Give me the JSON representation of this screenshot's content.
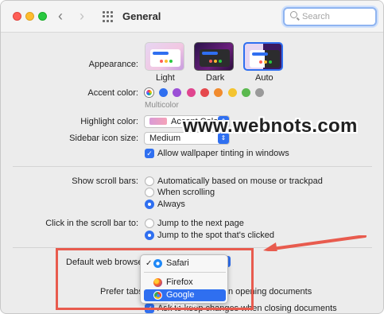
{
  "window": {
    "title": "General"
  },
  "search": {
    "placeholder": "Search"
  },
  "appearance": {
    "label": "Appearance:",
    "options": [
      {
        "label": "Light"
      },
      {
        "label": "Dark"
      },
      {
        "label": "Auto",
        "selected": true
      }
    ]
  },
  "accent": {
    "label": "Accent color:",
    "selected_caption": "Multicolor",
    "colors": [
      "#2f6ff0",
      "#9b4fd6",
      "#e0458f",
      "#e5484d",
      "#f18b2e",
      "#f4c430",
      "#5bb94f",
      "#9a9a9a"
    ]
  },
  "highlight": {
    "label": "Highlight color:",
    "value": "Accent Color"
  },
  "sidebar_icon": {
    "label": "Sidebar icon size:",
    "value": "Medium"
  },
  "wallpaper_tint": {
    "label": "Allow wallpaper tinting in windows",
    "checked": true
  },
  "scroll_bars": {
    "label": "Show scroll bars:",
    "options": [
      {
        "label": "Automatically based on mouse or trackpad",
        "selected": false
      },
      {
        "label": "When scrolling",
        "selected": false
      },
      {
        "label": "Always",
        "selected": true
      }
    ]
  },
  "click_scroll": {
    "label": "Click in the scroll bar to:",
    "options": [
      {
        "label": "Jump to the next page",
        "selected": false
      },
      {
        "label": "Jump to the spot that's clicked",
        "selected": true
      }
    ]
  },
  "default_browser": {
    "label": "Default web browser",
    "menu": [
      {
        "label": "Safari",
        "checked": true,
        "icon": "safari-icon"
      },
      {
        "label": "Firefox",
        "checked": false,
        "icon": "firefox-icon"
      },
      {
        "label": "Google Chrome",
        "checked": false,
        "icon": "chrome-icon",
        "highlighted": true
      }
    ]
  },
  "prefer_tabs": {
    "label": "Prefer tabs",
    "tail": "n opening documents"
  },
  "ask_keep": {
    "label": "Ask to keep changes when closing documents"
  },
  "watermark": "www.webnots.com",
  "annotation": {
    "color": "#e85b4e"
  }
}
